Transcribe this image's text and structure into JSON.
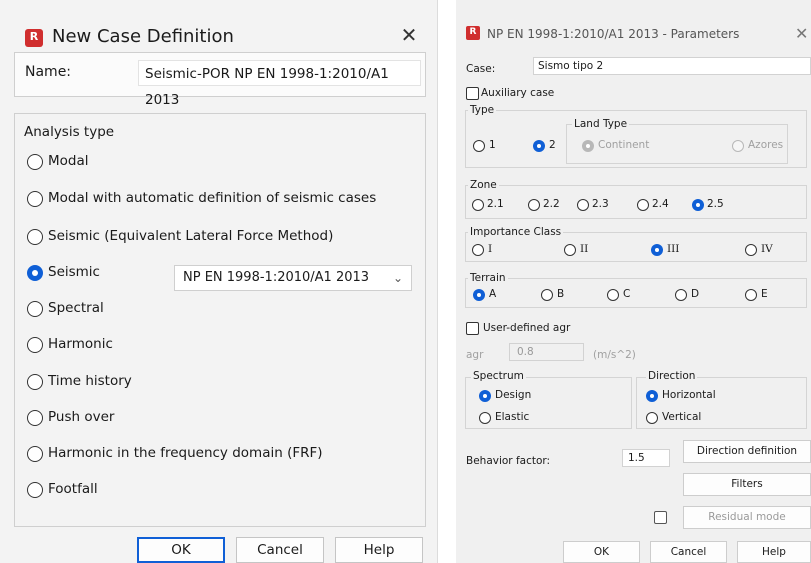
{
  "left": {
    "title": "New Case Definition",
    "close_glyph": "✕",
    "name_label": "Name:",
    "name_value": "Seismic-POR NP EN 1998-1:2010/A1 2013",
    "analysis_title": "Analysis type",
    "options": [
      "Modal",
      "Modal with automatic definition of seismic cases",
      "Seismic (Equivalent Lateral Force Method)",
      "Seismic",
      "Spectral",
      "Harmonic",
      "Time history",
      "Push over",
      "Harmonic in the frequency domain (FRF)",
      "Footfall"
    ],
    "selected_option": "Seismic",
    "code_select": "NP EN 1998-1:2010/A1 2013",
    "buttons": {
      "ok": "OK",
      "cancel": "Cancel",
      "help": "Help"
    }
  },
  "right": {
    "title": "NP EN 1998-1:2010/A1 2013 - Parameters",
    "close_glyph": "✕",
    "case_label": "Case:",
    "case_value": "Sismo tipo 2",
    "auxiliary": "Auxiliary case",
    "type": {
      "title": "Type",
      "opt1": "1",
      "opt2": "2",
      "selected": "2",
      "land_title": "Land Type",
      "continent": "Continent",
      "azores": "Azores"
    },
    "zone": {
      "title": "Zone",
      "options": [
        "2.1",
        "2.2",
        "2.3",
        "2.4",
        "2.5"
      ],
      "selected": "2.5"
    },
    "importance": {
      "title": "Importance Class",
      "options": [
        "I",
        "II",
        "III",
        "IV"
      ],
      "selected": "III"
    },
    "terrain": {
      "title": "Terrain",
      "options": [
        "A",
        "B",
        "C",
        "D",
        "E"
      ],
      "selected": "A"
    },
    "user_agr": "User-defined agr",
    "agr_label": "agr",
    "agr_value": "0.8",
    "agr_unit": "(m/s^2)",
    "spectrum": {
      "title": "Spectrum",
      "design": "Design",
      "elastic": "Elastic",
      "selected": "Design"
    },
    "direction": {
      "title": "Direction",
      "horizontal": "Horizontal",
      "vertical": "Vertical",
      "selected": "Horizontal"
    },
    "behavior_label": "Behavior factor:",
    "behavior_value": "1.5",
    "direction_definition": "Direction definition",
    "filters": "Filters",
    "residual_mode": "Residual mode",
    "buttons": {
      "ok": "OK",
      "cancel": "Cancel",
      "help": "Help"
    }
  }
}
